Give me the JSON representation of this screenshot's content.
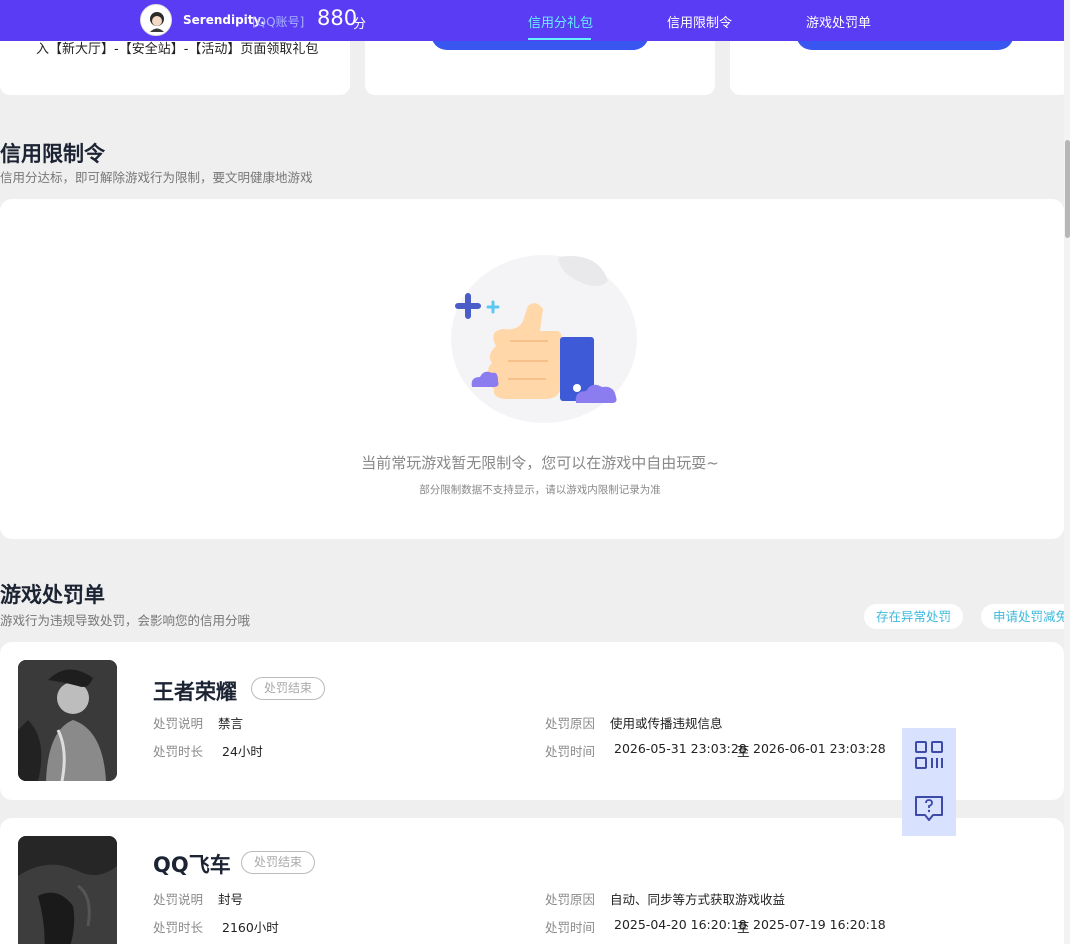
{
  "header": {
    "username": "Serendipity.",
    "account_tag": "[QQ账号]",
    "score": "880",
    "score_unit": "分",
    "tabs": [
      {
        "label": "信用分礼包",
        "active": true
      },
      {
        "label": "信用限制令",
        "active": false
      },
      {
        "label": "游戏处罚单",
        "active": false
      }
    ],
    "bar_color": "#5a3cf5",
    "active_color": "#66f0ff"
  },
  "top_cards": {
    "card1_text": "入【新大厅】-【安全站】-【活动】页面领取礼包"
  },
  "restriction": {
    "title": "信用限制令",
    "description": "信用分达标，即可解除游戏行为限制，要文明健康地游戏",
    "empty_message": "当前常玩游戏暂无限制令，您可以在游戏中自由玩耍~",
    "empty_note": "部分限制数据不支持显示，请以游戏内限制记录为准"
  },
  "penalty": {
    "title": "游戏处罚单",
    "description": "游戏行为违规导致处罚，会影响您的信用分哦",
    "actions": [
      "存在异常处罚",
      "申请处罚减免"
    ],
    "labels": {
      "explain": "处罚说明",
      "duration": "处罚时长",
      "reason": "处罚原因",
      "time": "处罚时间",
      "range_sep": "至"
    },
    "items": [
      {
        "game": "王者荣耀",
        "status": "处罚结束",
        "explain": "禁言",
        "duration": "24小时",
        "reason": "使用或传播违规信息",
        "start": "2026-05-31 23:03:28",
        "end": "2026-06-01 23:03:28"
      },
      {
        "game": "QQ飞车",
        "status": "处罚结束",
        "explain": "封号",
        "duration": "2160小时",
        "reason": "自动、同步等方式获取游戏收益",
        "start": "2025-04-20 16:20:18",
        "end": "2025-07-19 16:20:18"
      }
    ]
  },
  "floating": {
    "icons": [
      "qr-code-icon",
      "help-chat-icon"
    ]
  }
}
